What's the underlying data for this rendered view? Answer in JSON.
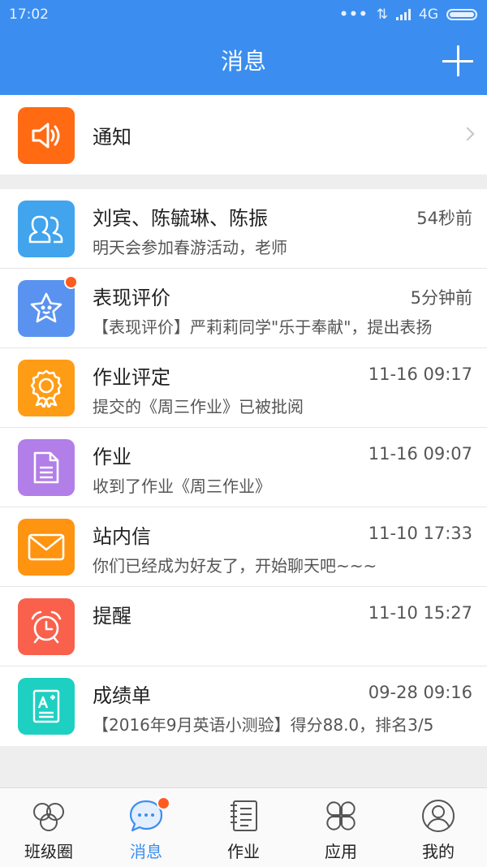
{
  "status_bar": {
    "time": "17:02",
    "network": "4G"
  },
  "header": {
    "title": "消息"
  },
  "notice": {
    "label": "通知",
    "icon": "speaker-icon",
    "color": "#ff6a13"
  },
  "messages": [
    {
      "title": "刘宾、陈毓琳、陈振",
      "time": "54秒前",
      "sub": "明天会参加春游活动，老师",
      "icon": "group-icon",
      "color": "#41a4ec",
      "unread": false
    },
    {
      "title": "表现评价",
      "time": "5分钟前",
      "sub": "【表现评价】严莉莉同学\"乐于奉献\"，提出表扬",
      "icon": "star-icon",
      "color": "#5a93ef",
      "unread": true
    },
    {
      "title": "作业评定",
      "time": "11-16 09:17",
      "sub": "提交的《周三作业》已被批阅",
      "icon": "badge-icon",
      "color": "#ff9c15",
      "unread": false
    },
    {
      "title": "作业",
      "time": "11-16 09:07",
      "sub": "收到了作业《周三作业》",
      "icon": "document-icon",
      "color": "#b27ee8",
      "unread": false
    },
    {
      "title": "站内信",
      "time": "11-10 17:33",
      "sub": "你们已经成为好友了，开始聊天吧~~~",
      "icon": "mail-icon",
      "color": "#ff9410",
      "unread": false
    },
    {
      "title": "提醒",
      "time": "11-10 15:27",
      "sub": "",
      "icon": "alarm-icon",
      "color": "#f9614d",
      "unread": false
    },
    {
      "title": "成绩单",
      "time": "09-28 09:16",
      "sub": "【2016年9月英语小测验】得分88.0，排名3/5",
      "icon": "report-icon",
      "color": "#1ed0c1",
      "unread": false
    }
  ],
  "tabs": [
    {
      "label": "班级圈",
      "icon": "circles-icon",
      "active": false
    },
    {
      "label": "消息",
      "icon": "chat-icon",
      "active": true
    },
    {
      "label": "作业",
      "icon": "notebook-icon",
      "active": false
    },
    {
      "label": "应用",
      "icon": "apps-icon",
      "active": false
    },
    {
      "label": "我的",
      "icon": "user-icon",
      "active": false
    }
  ],
  "colors": {
    "primary": "#3b8eef",
    "badge": "#ff5b1f"
  }
}
